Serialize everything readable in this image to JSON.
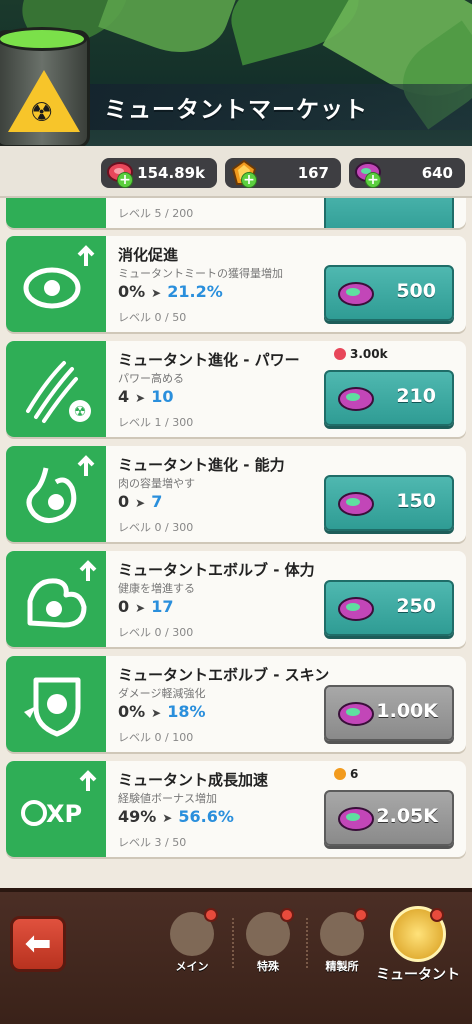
{
  "header": {
    "title": "ミュータントマーケット"
  },
  "currency": [
    {
      "icon": "meat-icon",
      "value": "154.89k"
    },
    {
      "icon": "amber-gem-icon",
      "value": "167"
    },
    {
      "icon": "mutant-meat-icon",
      "value": "640"
    }
  ],
  "partial_card": {
    "level": "レベル 5 / 200"
  },
  "upgrades": [
    {
      "name": "消化促進",
      "desc": "ミュータントミートの獲得量増加",
      "current": "0%",
      "next": "21.2%",
      "level": "レベル 0 / 50",
      "cost": "500",
      "button_state": "teal",
      "icon": "steak-up-icon",
      "requirement": ""
    },
    {
      "name": "ミュータント進化 - パワー",
      "desc": "パワー高める",
      "current": "4",
      "next": "10",
      "level": "レベル 1 / 300",
      "cost": "210",
      "button_state": "teal",
      "icon": "claw-marks-icon",
      "requirement": "3.00k"
    },
    {
      "name": "ミュータント進化 - 能力",
      "desc": "肉の容量増やす",
      "current": "0",
      "next": "7",
      "level": "レベル 0 / 300",
      "cost": "150",
      "button_state": "teal",
      "icon": "stomach-icon",
      "requirement": ""
    },
    {
      "name": "ミュータントエボルブ - 体力",
      "desc": "健康を増進する",
      "current": "0",
      "next": "17",
      "level": "レベル 0 / 300",
      "cost": "250",
      "button_state": "teal",
      "icon": "flexed-arm-icon",
      "requirement": ""
    },
    {
      "name": "ミュータントエボルブ - スキン",
      "desc": "ダメージ軽減強化",
      "current": "0%",
      "next": "18%",
      "level": "レベル 0 / 100",
      "cost": "1.00K",
      "button_state": "grey",
      "icon": "shield-icon",
      "requirement": ""
    },
    {
      "name": "ミュータント成長加速",
      "desc": "経験値ボーナス増加",
      "current": "49%",
      "next": "56.6%",
      "level": "レベル 3 / 50",
      "cost": "2.05K",
      "button_state": "grey",
      "icon": "xp-icon",
      "requirement": "6"
    }
  ],
  "nav": [
    {
      "label": "メイン",
      "icon": "dna-icon",
      "badge": true
    },
    {
      "label": "特殊",
      "icon": "flask-icon",
      "badge": true
    },
    {
      "label": "精製所",
      "icon": "refinery-icon",
      "badge": true
    },
    {
      "label": "ミュータント",
      "icon": "radiation-icon",
      "badge": true,
      "active": true
    }
  ],
  "colors": {
    "accent_green": "#2fae56",
    "teal_button": "#3fae a6",
    "grey_button": "#9a9a9a",
    "link_blue": "#2a8fdc"
  }
}
